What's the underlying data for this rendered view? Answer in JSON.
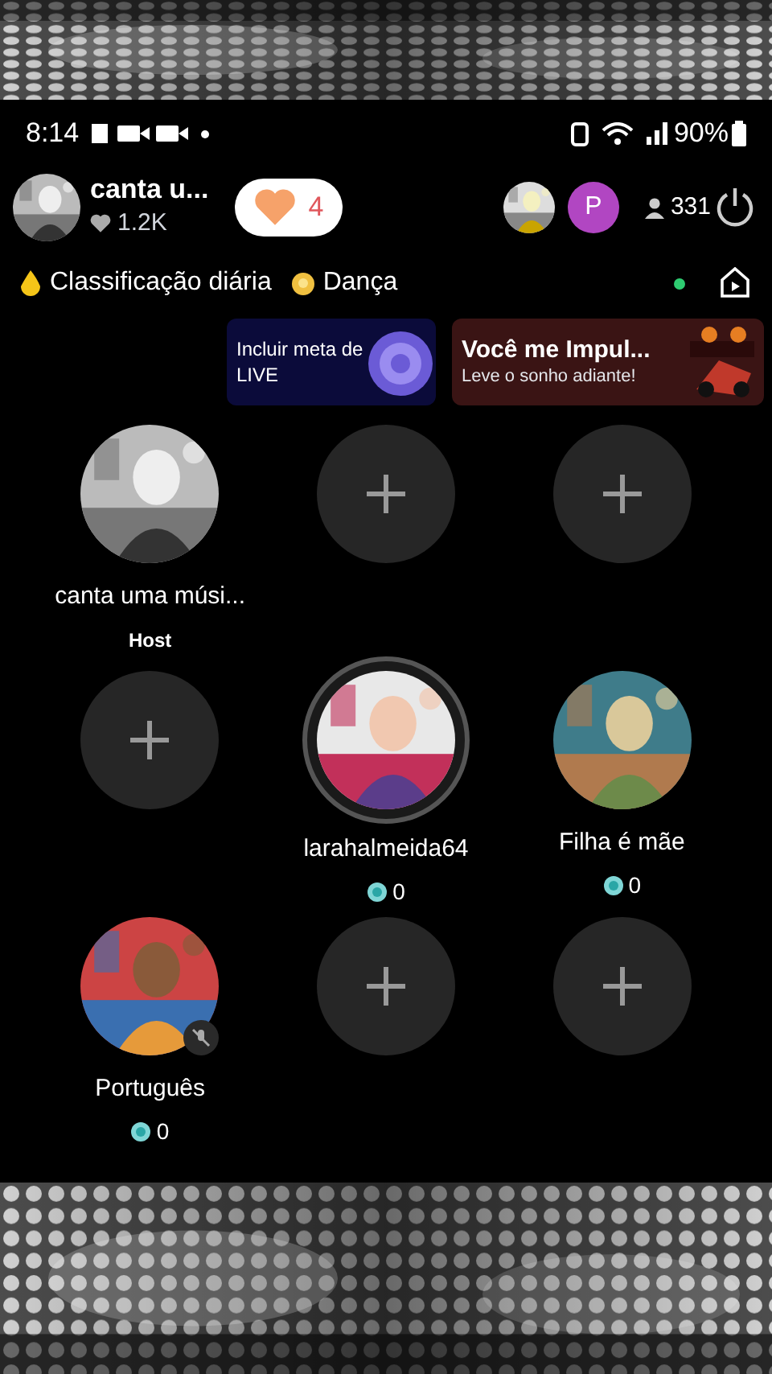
{
  "status_bar": {
    "time": "8:14",
    "battery": "90%"
  },
  "header": {
    "host_name": "canta u...",
    "likes": "1.2K",
    "heart_count": "4",
    "viewer_count": "331"
  },
  "viewers": [
    {
      "kind": "picture"
    },
    {
      "kind": "initial",
      "initial": "P"
    }
  ],
  "tags": [
    {
      "kind": "ranking",
      "label": "Classificação diária"
    },
    {
      "kind": "category",
      "label": "Dança"
    }
  ],
  "banners": [
    {
      "kind": "goal",
      "title": "Incluir meta de LIVE"
    },
    {
      "kind": "promo",
      "title": "Você me Impul...",
      "subtitle": "Leve o sonho adiante!"
    }
  ],
  "seats": [
    {
      "kind": "user",
      "name": "canta uma músi...",
      "role": "Host",
      "speaking": false,
      "muted": false
    },
    {
      "kind": "empty"
    },
    {
      "kind": "empty"
    },
    {
      "kind": "empty"
    },
    {
      "kind": "user",
      "name": "larahalmeida64",
      "score": "0",
      "speaking": true,
      "muted": false
    },
    {
      "kind": "user",
      "name": "Filha é mãe",
      "score": "0",
      "speaking": false,
      "muted": false
    },
    {
      "kind": "user",
      "name": "Português",
      "score": "0",
      "speaking": false,
      "muted": true
    },
    {
      "kind": "empty"
    },
    {
      "kind": "empty"
    }
  ]
}
